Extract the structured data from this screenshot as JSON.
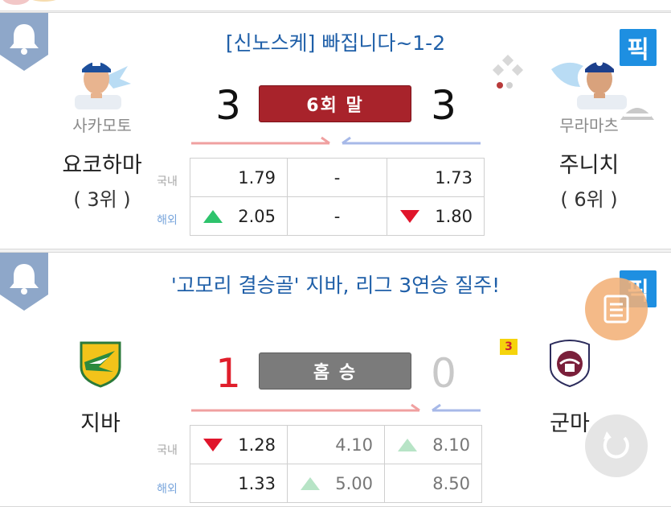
{
  "colors": {
    "headline": "#1f5fa8",
    "pick_badge": "#1e8fe1",
    "status_live": "#a8232b",
    "status_final": "#7b7b7b",
    "winner_score": "#e01e2b",
    "loser_score": "#c8c8c8",
    "odds_up": "#2ec36c",
    "odds_down": "#e0152b"
  },
  "games": [
    {
      "headline": "[신노스케]  빠집니다~1-2",
      "pick_label": "픽",
      "home": {
        "pitcher": "사카모토",
        "name": "요코하마",
        "rank": "( 3위 )",
        "score": "3",
        "logo": "baystars-player-icon"
      },
      "away": {
        "pitcher": "무라마츠",
        "name": "주니치",
        "rank": "( 6위 )",
        "score": "3",
        "logo": "dragons-player-icon"
      },
      "status": "6회 말",
      "odds_labels": {
        "domestic": "국내",
        "overseas": "해외"
      },
      "odds": {
        "domestic": {
          "home": "1.79",
          "draw": "-",
          "away": "1.73"
        },
        "overseas": {
          "home": "2.05",
          "draw": "-",
          "away": "1.80"
        }
      },
      "trends": {
        "overseas_home": "up",
        "overseas_away": "down"
      }
    },
    {
      "headline": "'고모리 결승골' 지바, 리그 3연승 질주!",
      "pick_label": "픽",
      "home": {
        "name": "지바",
        "score": "1",
        "logo": "jef-united-logo"
      },
      "away": {
        "name": "군마",
        "score": "0",
        "logo": "thespa-gunma-logo",
        "badge": "3"
      },
      "status": "홈 승",
      "odds_labels": {
        "domestic": "국내",
        "overseas": "해외"
      },
      "odds": {
        "domestic": {
          "home": "1.28",
          "draw": "4.10",
          "away": "8.10"
        },
        "overseas": {
          "home": "1.33",
          "draw": "5.00",
          "away": "8.50"
        }
      },
      "trends": {
        "domestic_home": "down",
        "domestic_away": "up",
        "overseas_draw": "up"
      }
    }
  ]
}
